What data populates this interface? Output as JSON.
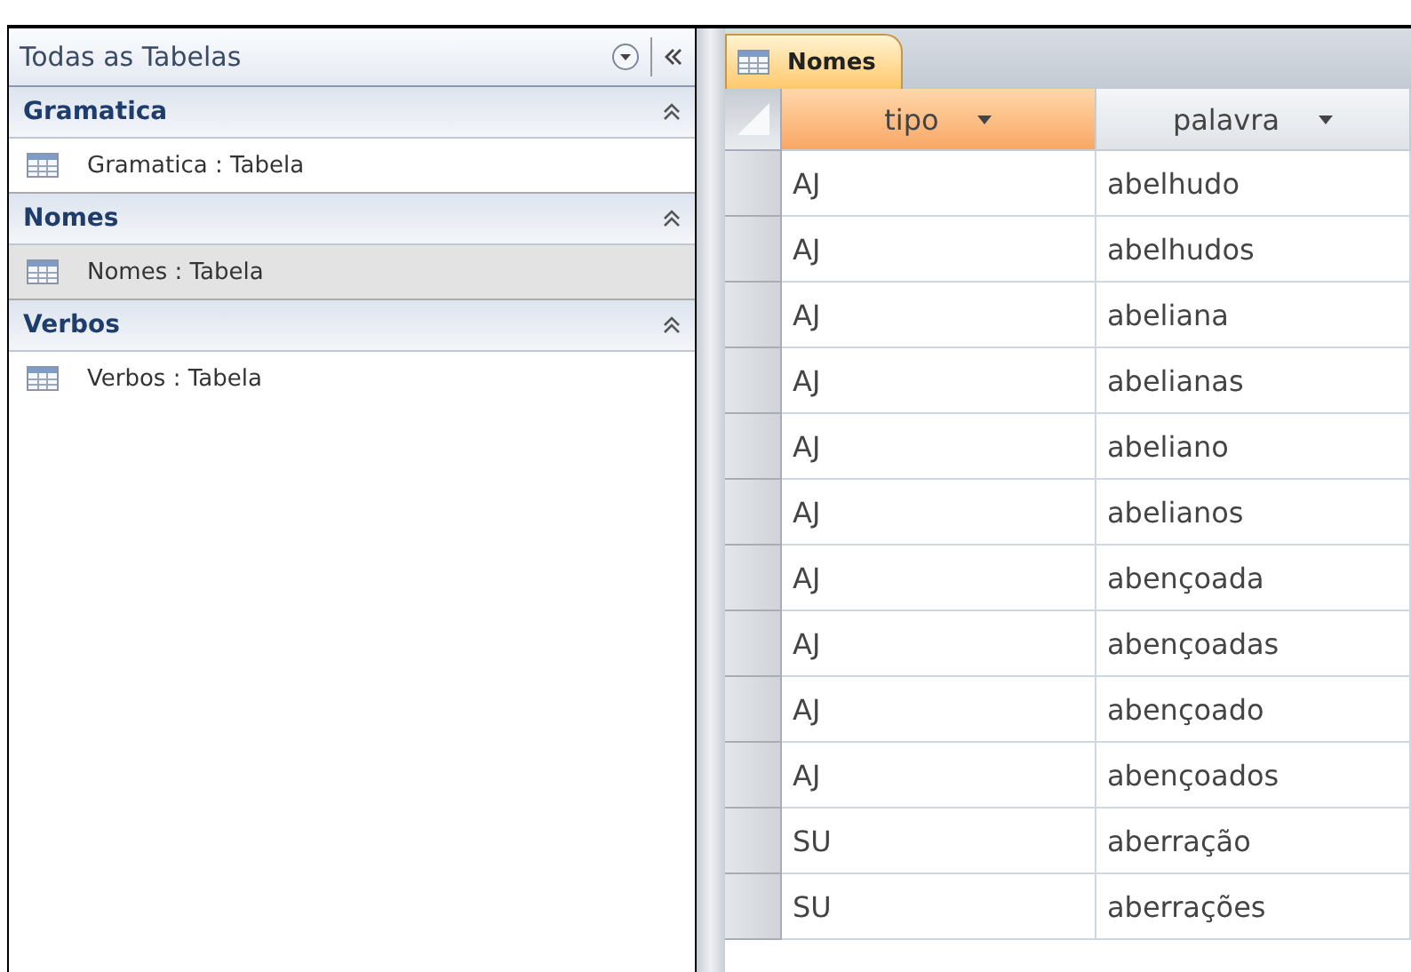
{
  "nav_pane": {
    "title": "Todas as Tabelas",
    "groups": [
      {
        "name": "Gramatica",
        "items": [
          {
            "label": "Gramatica : Tabela",
            "selected": false
          }
        ]
      },
      {
        "name": "Nomes",
        "items": [
          {
            "label": "Nomes : Tabela",
            "selected": true
          }
        ]
      },
      {
        "name": "Verbos",
        "items": [
          {
            "label": "Verbos : Tabela",
            "selected": false
          }
        ]
      }
    ]
  },
  "tabs": [
    {
      "label": "Nomes",
      "selected": true
    }
  ],
  "table": {
    "columns": [
      {
        "label": "tipo",
        "selected": true
      },
      {
        "label": "palavra",
        "selected": false
      }
    ],
    "rows": [
      [
        "AJ",
        "abelhudo"
      ],
      [
        "AJ",
        "abelhudos"
      ],
      [
        "AJ",
        "abeliana"
      ],
      [
        "AJ",
        "abelianas"
      ],
      [
        "AJ",
        "abeliano"
      ],
      [
        "AJ",
        "abelianos"
      ],
      [
        "AJ",
        "abençoada"
      ],
      [
        "AJ",
        "abençoadas"
      ],
      [
        "AJ",
        "abençoado"
      ],
      [
        "AJ",
        "abençoados"
      ],
      [
        "SU",
        "aberração"
      ],
      [
        "SU",
        "aberrações"
      ]
    ]
  }
}
